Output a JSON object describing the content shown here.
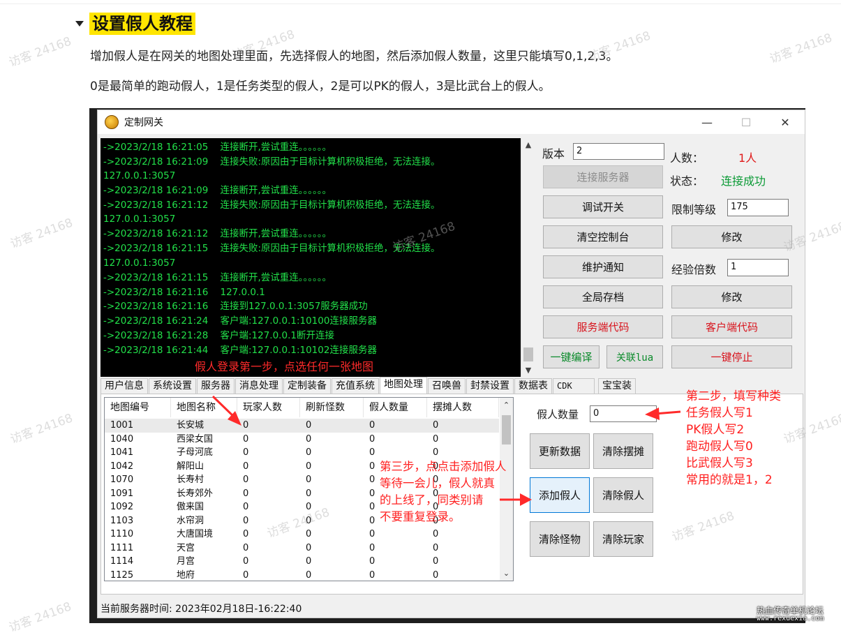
{
  "heading": "设置假人教程",
  "paragraphs": [
    "增加假人是在网关的地图处理里面，先选择假人的地图，然后添加假人数量，这里只能填写0,1,2,3。",
    "0是最简单的跑动假人，1是任务类型的假人，2是可以PK的假人，3是比武台上的假人。"
  ],
  "window": {
    "title": "定制网关",
    "controls": [
      "—",
      "☐",
      "✕"
    ]
  },
  "console": {
    "lines": [
      "->2023/2/18 16:21:05    连接断开,尝试重连。。。。。。",
      "->2023/2/18 16:21:09    连接失败:原因由于目标计算机积极拒绝，无法连接。",
      "127.0.0.1:3057",
      "->2023/2/18 16:21:09    连接断开,尝试重连。。。。。。",
      "->2023/2/18 16:21:12    连接失败:原因由于目标计算机积极拒绝，无法连接。",
      "127.0.0.1:3057",
      "->2023/2/18 16:21:12    连接断开,尝试重连。。。。。。",
      "->2023/2/18 16:21:15    连接失败:原因由于目标计算机积极拒绝，无法连接。",
      "127.0.0.1:3057",
      "->2023/2/18 16:21:15    连接断开,尝试重连。。。。。。",
      "->2023/2/18 16:21:16    127.0.0.1",
      "->2023/2/18 16:21:16    连接到127.0.0.1:3057服务器成功",
      "->2023/2/18 16:21:24    客户端:127.0.0.1:10100连接服务器",
      "->2023/2/18 16:21:28    客户端:127.0.0.1断开连接",
      "->2023/2/18 16:21:44    客户端:127.0.0.1:10102连接服务器"
    ],
    "annotation": "假人登录第一步，点选任何一张地图"
  },
  "controls": {
    "version_label": "版本",
    "version_value": "2",
    "players_label": "人数：",
    "players_value": "1人",
    "status_label": "状态：",
    "status_value": "连接成功",
    "level_label": "限制等级",
    "level_value": "175",
    "exp_label": "经验倍数",
    "exp_value": "1",
    "connect_btn": "连接服务器",
    "debug_btn": "调试开关",
    "clear_console_btn": "清空控制台",
    "modify_btn_1": "修改",
    "maintenance_btn": "维护通知",
    "global_save_btn": "全局存档",
    "modify_btn_2": "修改",
    "server_code_btn": "服务端代码",
    "client_code_btn": "客户端代码",
    "compile_btn": "一键编译",
    "lua_btn": "关联lua",
    "stop_btn": "一键停止"
  },
  "tabs": [
    "用户信息",
    "系统设置",
    "服务器",
    "消息处理",
    "定制装备",
    "充值系统",
    "地图处理",
    "召唤兽",
    "封禁设置",
    "数据表",
    "CDK",
    "宝宝装"
  ],
  "active_tab": 6,
  "map_table": {
    "headers": [
      "地图编号",
      "地图名称",
      "玩家人数",
      "刷新怪数",
      "假人数量",
      "摆摊人数"
    ],
    "rows": [
      [
        "1001",
        "长安城",
        "0",
        "0",
        "0",
        "0"
      ],
      [
        "1040",
        "西梁女国",
        "0",
        "0",
        "0",
        "0"
      ],
      [
        "1041",
        "子母河底",
        "0",
        "0",
        "0",
        "0"
      ],
      [
        "1042",
        "解阳山",
        "0",
        "0",
        "0",
        "0"
      ],
      [
        "1070",
        "长寿村",
        "0",
        "0",
        "0",
        "0"
      ],
      [
        "1091",
        "长寿郊外",
        "0",
        "0",
        "0",
        "0"
      ],
      [
        "1092",
        "傲来国",
        "0",
        "0",
        "0",
        "0"
      ],
      [
        "1103",
        "水帘洞",
        "0",
        "0",
        "0",
        "0"
      ],
      [
        "1110",
        "大唐国境",
        "0",
        "0",
        "0",
        "0"
      ],
      [
        "1111",
        "天宫",
        "0",
        "0",
        "0",
        "0"
      ],
      [
        "1114",
        "月宫",
        "0",
        "0",
        "0",
        "0"
      ],
      [
        "1125",
        "地府",
        "0",
        "0",
        "0",
        "0"
      ]
    ]
  },
  "map_panel": {
    "bot_count_label": "假人数量",
    "bot_count_value": "0",
    "refresh_btn": "更新数据",
    "clear_stalls_btn": "清除摆摊",
    "add_bots_btn": "添加假人",
    "clear_bots_btn": "清除假人",
    "clear_monsters_btn": "清除怪物",
    "clear_players_btn": "清除玩家"
  },
  "annotations": {
    "step2": [
      "第二步，填写种类",
      "任务假人写1",
      "PK假人写2",
      "跑动假人写0",
      "比武假人写3",
      "常用的就是1，2"
    ],
    "step3": [
      "第三步，点点击添加假人",
      "等待一会儿，假人就真",
      "的上线了，同类别请",
      "不要重复登录。"
    ]
  },
  "status_bar": "当前服务器时间:  2023年02月18日-16:22:40",
  "watermark": "访客 24168",
  "footer": {
    "site_name": "热血传奇单机论坛",
    "site_url": "www.rexuexia.com"
  },
  "colors": {
    "console_bg": "#000000",
    "console_text": "#22e04a",
    "annotation_red": "#ff2020",
    "heading_highlight": "#ffe500"
  }
}
